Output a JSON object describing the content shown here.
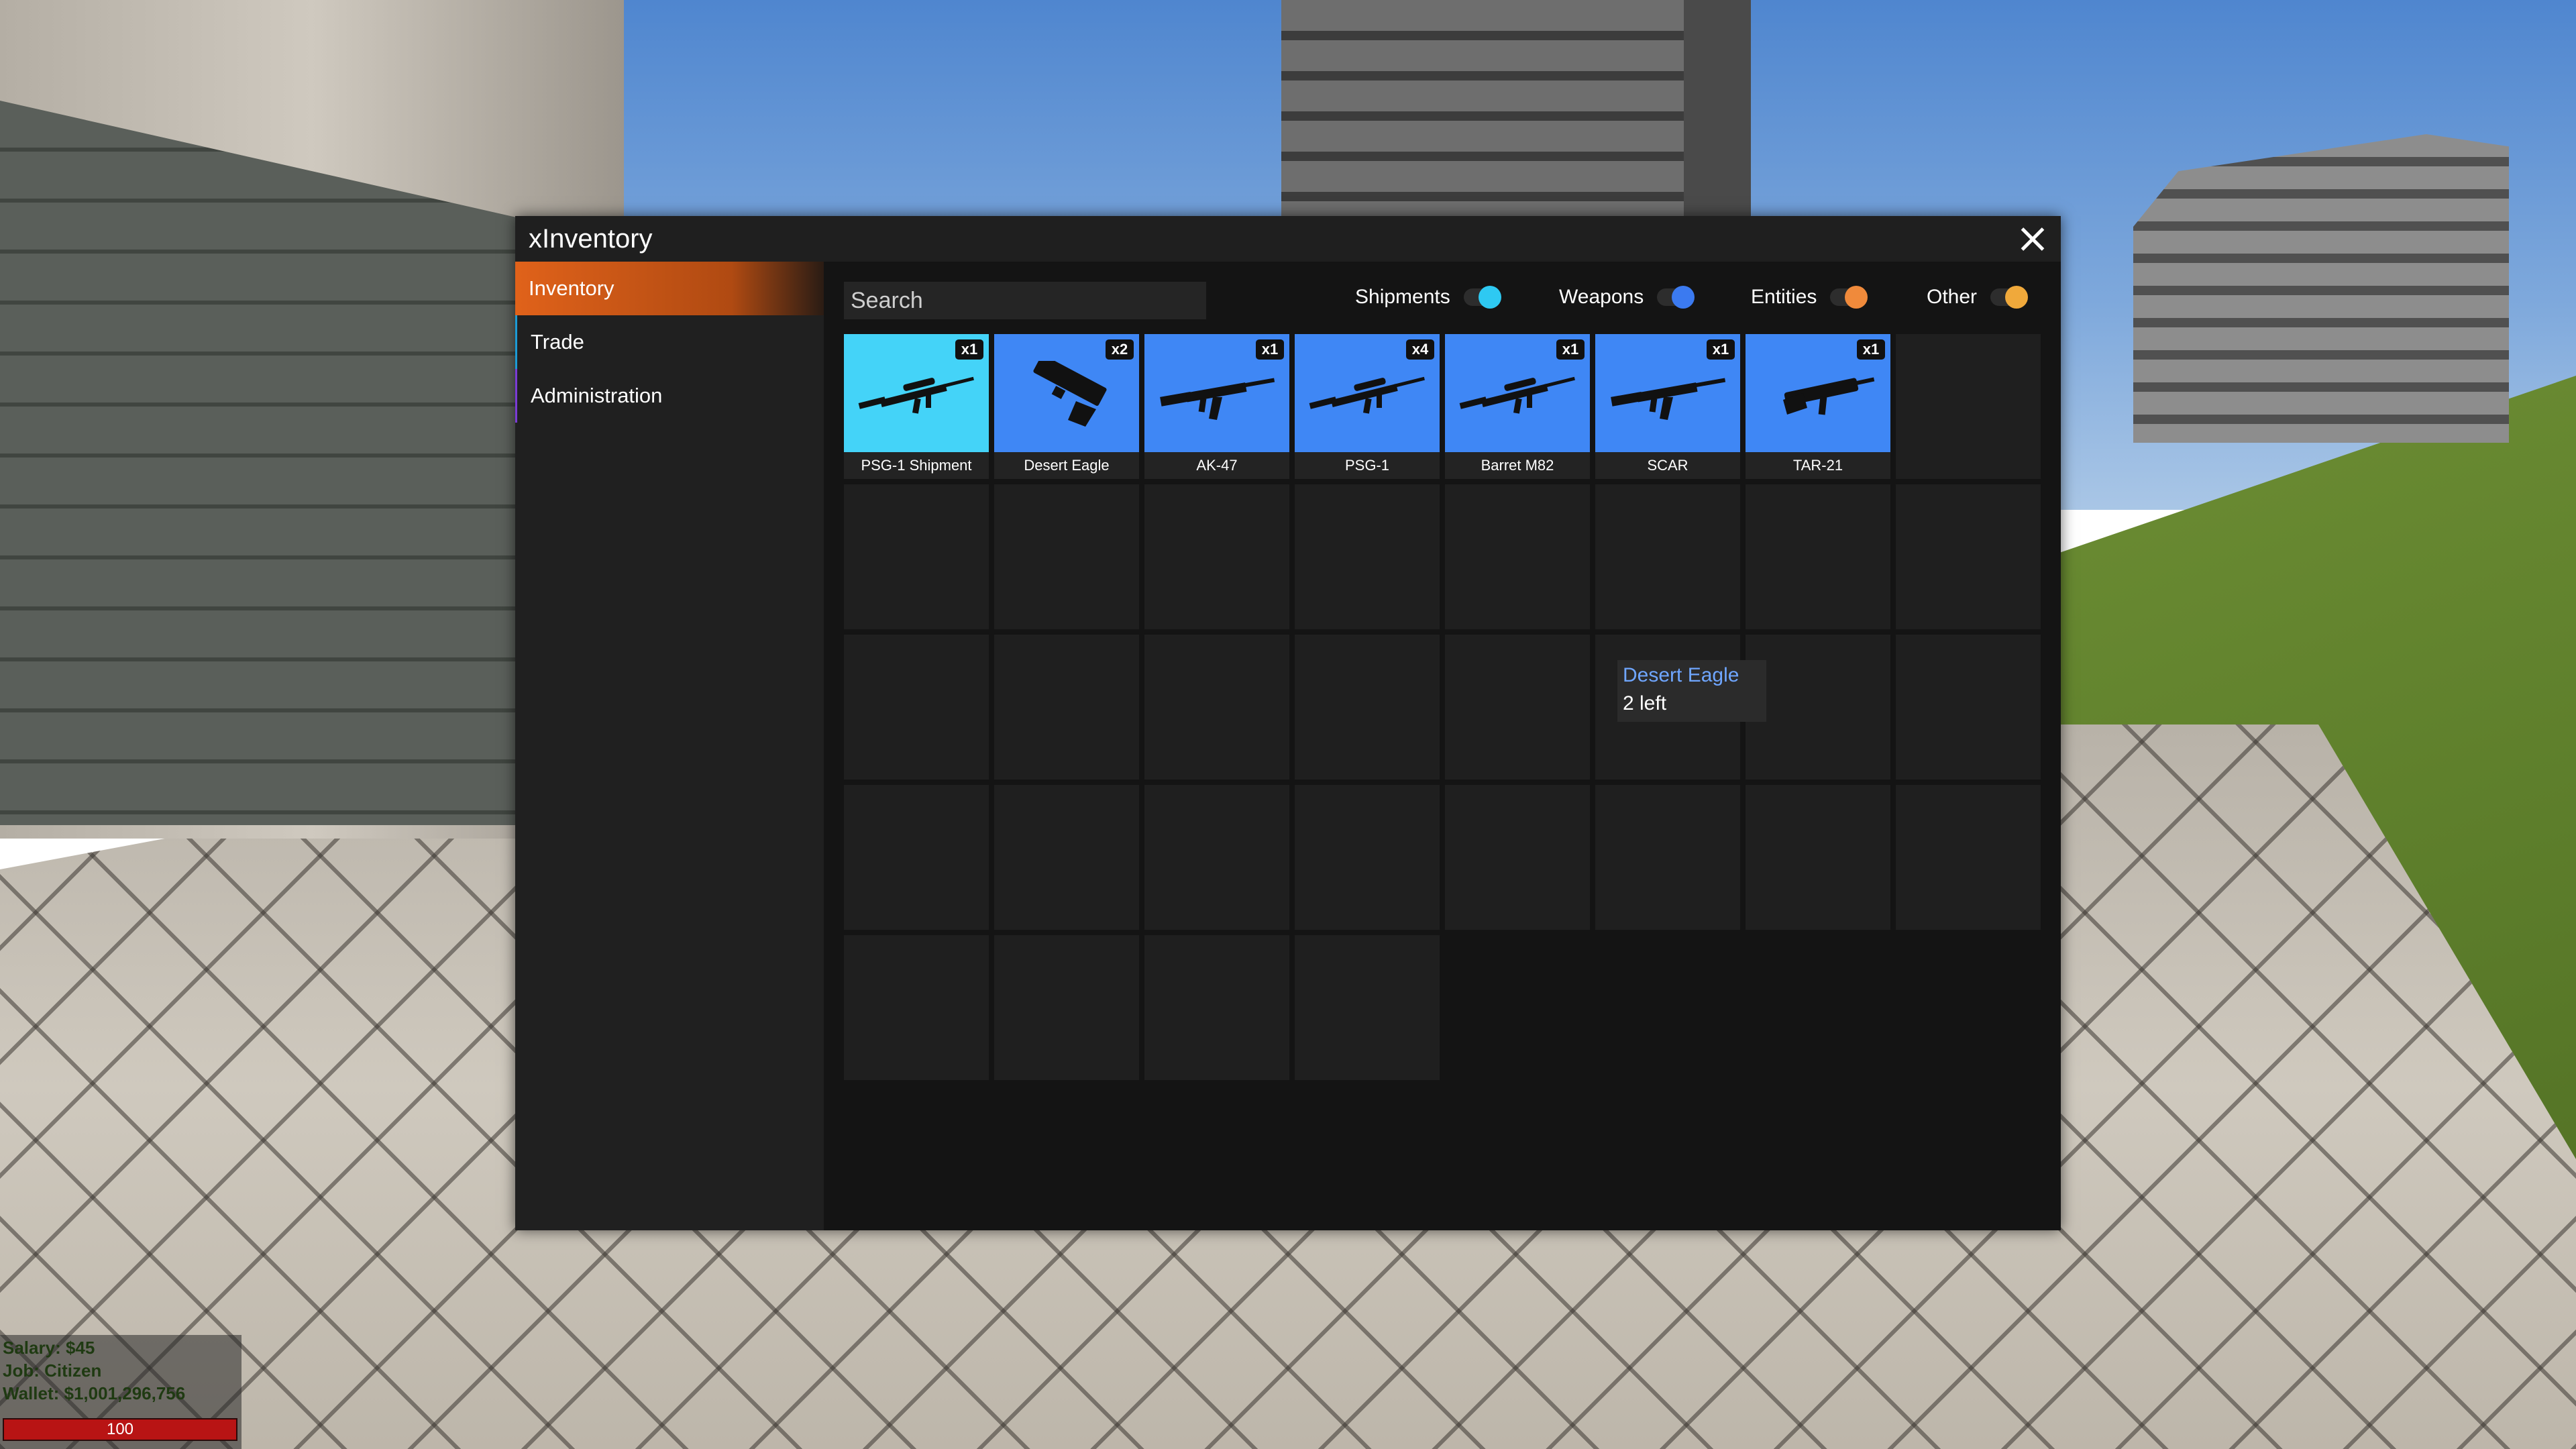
{
  "window": {
    "title": "xInventory"
  },
  "sidebar": {
    "items": [
      {
        "label": "Inventory",
        "active": true
      },
      {
        "label": "Trade",
        "active": false
      },
      {
        "label": "Administration",
        "active": false
      }
    ]
  },
  "search": {
    "placeholder": "Search"
  },
  "filters": [
    {
      "label": "Shipments",
      "enabled": true,
      "color": "#2ec9f2"
    },
    {
      "label": "Weapons",
      "enabled": true,
      "color": "#3b7af0"
    },
    {
      "label": "Entities",
      "enabled": true,
      "color": "#f08a3b"
    },
    {
      "label": "Other",
      "enabled": true,
      "color": "#f0a93b"
    }
  ],
  "inventory": {
    "colors": {
      "shipment": "#44d3f8",
      "weapon": "#3f87f5"
    },
    "items": [
      {
        "label": "PSG-1 Shipment",
        "qty": "x1",
        "type": "shipment",
        "icon": "sniper-rifle-icon"
      },
      {
        "label": "Desert Eagle",
        "qty": "x2",
        "type": "weapon",
        "icon": "pistol-icon"
      },
      {
        "label": "AK-47",
        "qty": "x1",
        "type": "weapon",
        "icon": "assault-rifle-icon"
      },
      {
        "label": "PSG-1",
        "qty": "x4",
        "type": "weapon",
        "icon": "sniper-rifle-icon"
      },
      {
        "label": "Barret M82",
        "qty": "x1",
        "type": "weapon",
        "icon": "sniper-rifle-icon"
      },
      {
        "label": "SCAR",
        "qty": "x1",
        "type": "weapon",
        "icon": "assault-rifle-icon"
      },
      {
        "label": "TAR-21",
        "qty": "x1",
        "type": "weapon",
        "icon": "bullpup-rifle-icon"
      }
    ],
    "total_slots": 36
  },
  "tooltip": {
    "name": "Desert Eagle",
    "detail": "2 left"
  },
  "hud": {
    "salary": "Salary: $45",
    "job": "Job: Citizen",
    "wallet": "Wallet: $1,001,296,756",
    "health": "100",
    "health_fraction": 1.0
  }
}
